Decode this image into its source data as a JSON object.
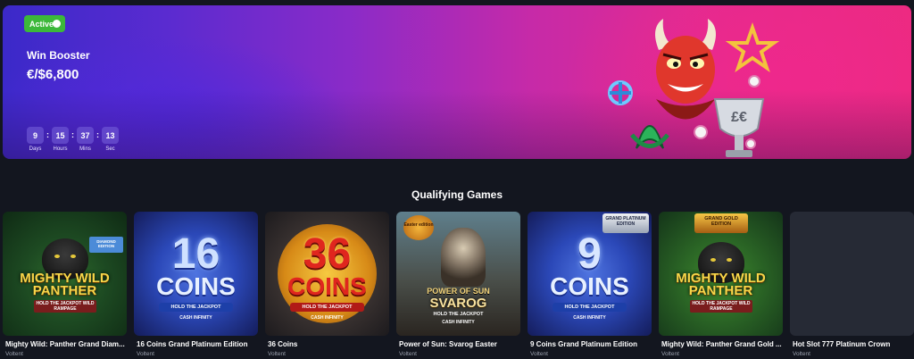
{
  "banner": {
    "status": "Active",
    "name": "Win Booster",
    "amount": "€/$6,800",
    "countdown": [
      {
        "value": "9",
        "label": "Days"
      },
      {
        "value": "15",
        "label": "Hours"
      },
      {
        "value": "37",
        "label": "Mins"
      },
      {
        "value": "13",
        "label": "Sec"
      }
    ],
    "colors": {
      "active": "#3cb83a",
      "gradient_start": "#3b29c9",
      "gradient_end": "#ec2a7e"
    }
  },
  "section": {
    "title": "Qualifying Games"
  },
  "games": [
    {
      "title": "Mighty Wild: Panther Grand Diam...",
      "provider": "Voltent",
      "art": {
        "logo_top": "MIGHTY WILD",
        "logo_bottom": "PANTHER",
        "sub": "HOLD THE JACKPOT WILD RAMPAGE",
        "tag": "DIAMOND EDITION"
      }
    },
    {
      "title": "16 Coins Grand Platinum Edition",
      "provider": "Voltent",
      "art": {
        "number": "16",
        "word": "COINS",
        "jackpot": "HOLD THE JACKPOT",
        "cash": "CASH INFINITY"
      }
    },
    {
      "title": "36 Coins",
      "provider": "Voltent",
      "art": {
        "number": "36",
        "word": "COINS",
        "jackpot": "HOLD THE JACKPOT",
        "cash": "CASH INFINITY"
      }
    },
    {
      "title": "Power of Sun: Svarog Easter",
      "provider": "Voltent",
      "art": {
        "logo_top": "POWER OF SUN",
        "logo_bottom": "SVAROG",
        "jackpot": "HOLD THE JACKPOT",
        "cash": "CASH INFINITY",
        "tag": "Easter edition"
      }
    },
    {
      "title": "9 Coins Grand Platinum Edition",
      "provider": "Voltent",
      "art": {
        "number": "9",
        "word": "COINS",
        "jackpot": "HOLD THE JACKPOT",
        "cash": "CASH INFINITY",
        "tag": "GRAND PLATINUM EDITION"
      }
    },
    {
      "title": "Mighty Wild: Panther Grand Gold ...",
      "provider": "Voltent",
      "art": {
        "logo_top": "MIGHTY WILD",
        "logo_bottom": "PANTHER",
        "sub": "HOLD THE JACKPOT WILD RAMPAGE",
        "tag": "GRAND GOLD EDITION"
      }
    },
    {
      "title": "Hot Slot 777 Platinum Crown",
      "provider": "Voltent"
    }
  ]
}
